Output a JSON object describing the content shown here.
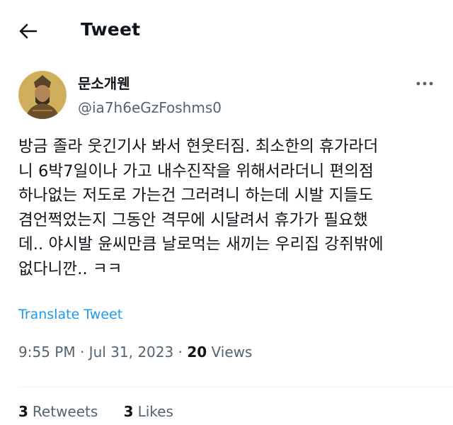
{
  "header": {
    "title": "Tweet",
    "back_icon": "arrow-left-icon"
  },
  "author": {
    "display_name": "문소개웬",
    "handle": "@ia7h6eGzFoshms0",
    "avatar_icon": "avatar-portrait",
    "more_icon": "more-dots-icon"
  },
  "tweet": {
    "lines": [
      "방금 졸라 웃긴기사 봐서 현웃터짐. 최소한의 휴가라더",
      "니 6박7일이나 가고 내수진작을 위해서라더니 편의점",
      "하나없는 저도로 가는건 그러려니 하는데 시발 지들도",
      "겸언쩍었는지 그동안 격무에 시달려서 휴가가 필요했",
      "데.. 야시발 윤씨만큼 날로먹는 새끼는 우리집 강쥐밖에",
      "없다니깐.. ㅋㅋ"
    ],
    "translate_label": "Translate Tweet"
  },
  "meta": {
    "time": "9:55 PM",
    "separator": " · ",
    "date": "Jul 31, 2023",
    "views_count": "20",
    "views_label": "Views"
  },
  "stats": {
    "retweets_count": "3",
    "retweets_label": "Retweets",
    "likes_count": "3",
    "likes_label": "Likes"
  },
  "colors": {
    "text": "#0f1419",
    "secondary": "#536471",
    "link": "#1d9bf0",
    "divider": "#eff3f4"
  }
}
